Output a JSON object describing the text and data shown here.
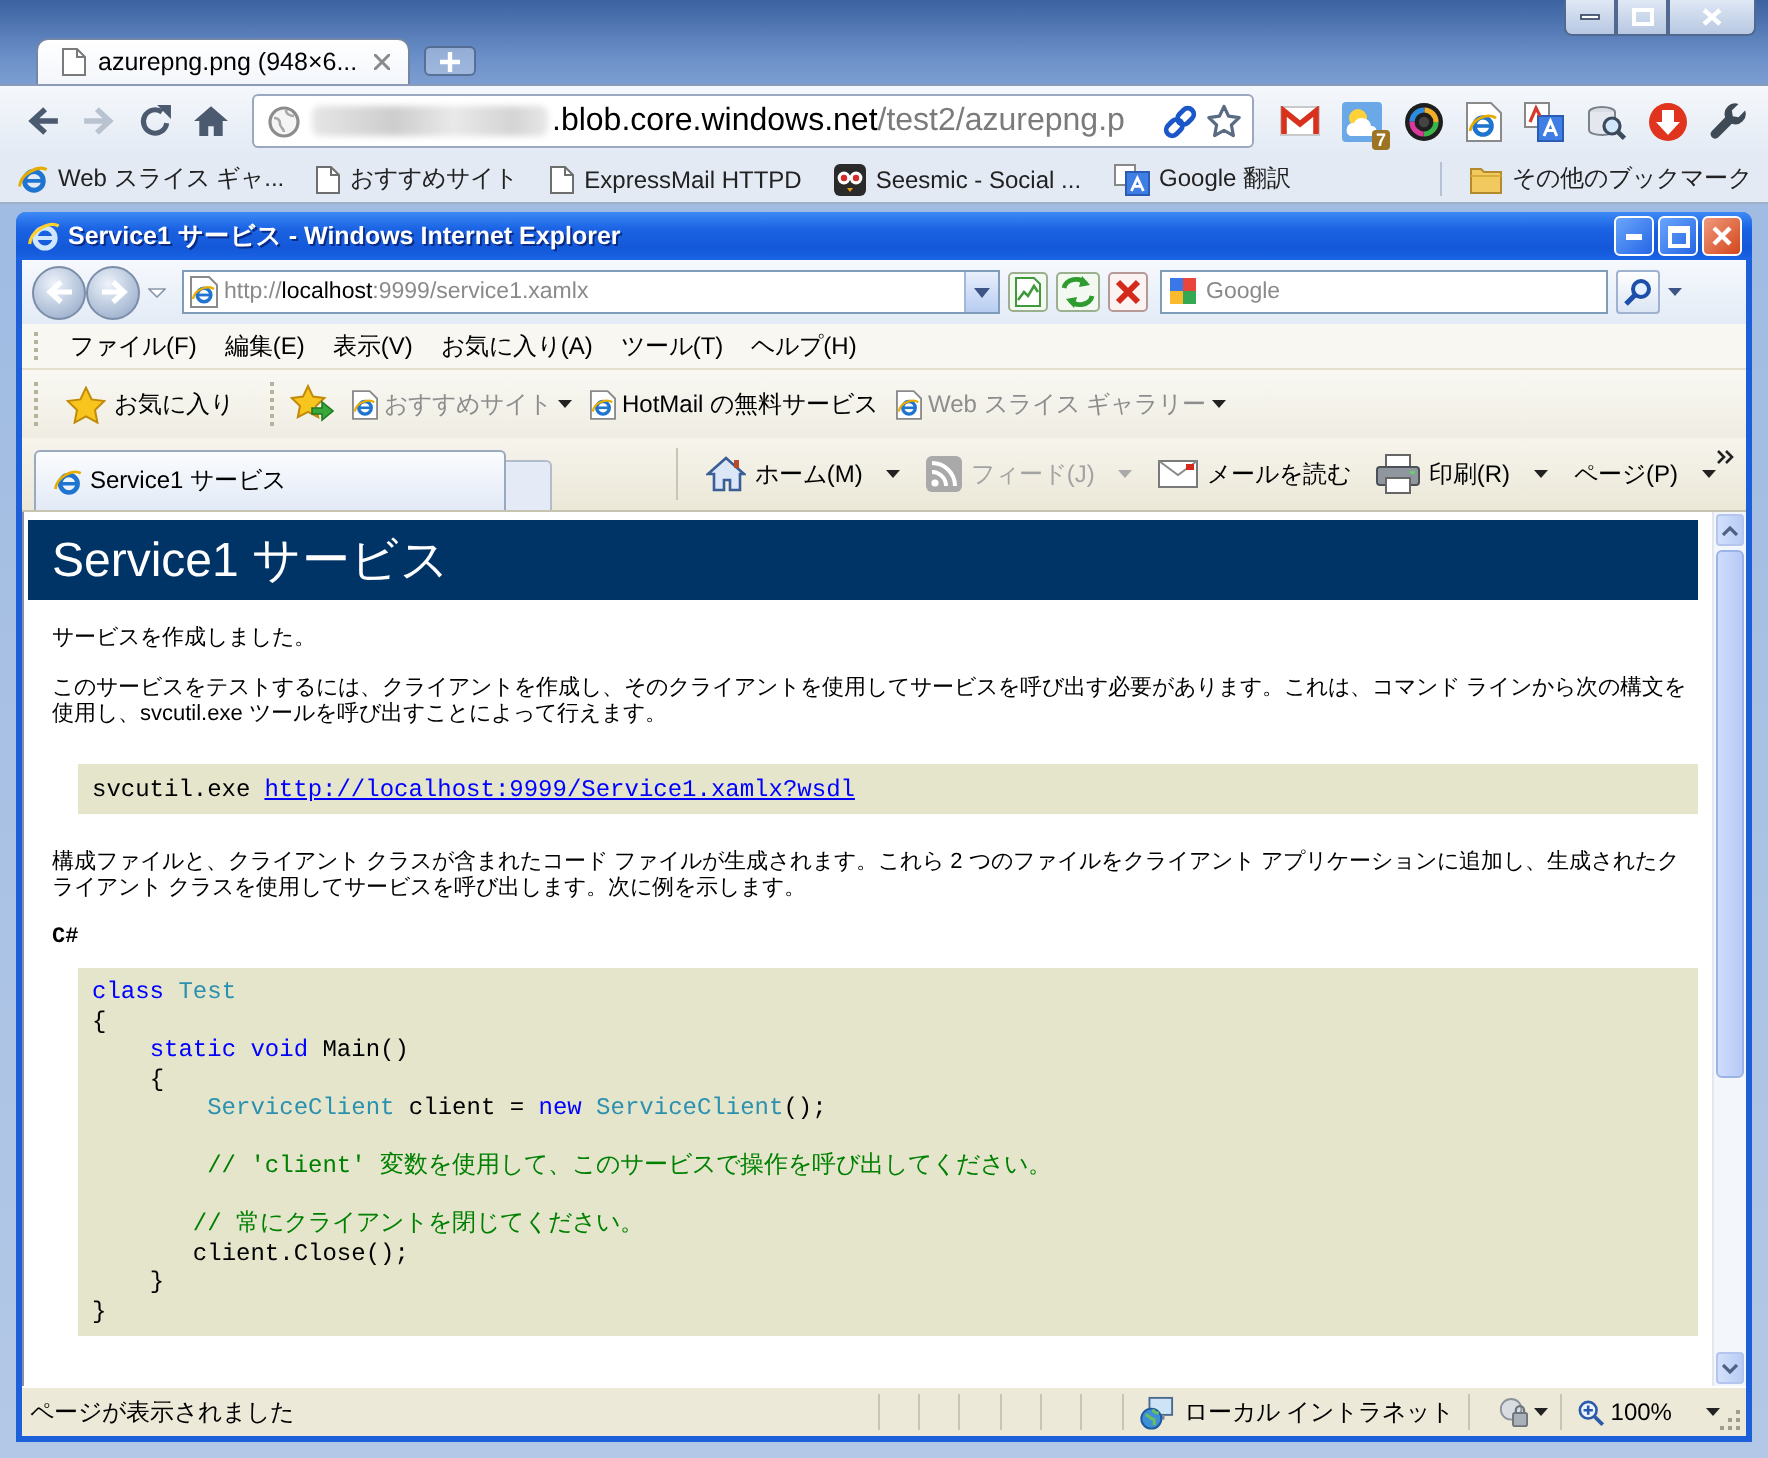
{
  "browser": {
    "tabs": [
      {
        "title": "azurepng.png (948×6...",
        "selected": true
      }
    ],
    "omnibox": {
      "host": ".blob.core.windows.net",
      "path": "/test2/azurepng.p"
    },
    "extension_badge": "7",
    "bookmarks": [
      {
        "label": "Web スライス ギャ...",
        "kind": "ie"
      },
      {
        "label": "おすすめサイト",
        "kind": "page"
      },
      {
        "label": "ExpressMail HTTPD",
        "kind": "page"
      },
      {
        "label": "Seesmic - Social ...",
        "kind": "owl"
      },
      {
        "label": "Google 翻訳",
        "kind": "translate"
      }
    ],
    "other_bookmarks": "その他のブックマーク"
  },
  "ie": {
    "title": "Service1 サービス - Windows Internet Explorer",
    "address": {
      "scheme": "http://",
      "host": "localhost",
      "rest": ":9999/service1.xamlx"
    },
    "search": {
      "placeholder": "Google"
    },
    "menu": [
      "ファイル(F)",
      "編集(E)",
      "表示(V)",
      "お気に入り(A)",
      "ツール(T)",
      "ヘルプ(H)"
    ],
    "favorites": {
      "label": "お気に入り",
      "links": [
        {
          "label": "おすすめサイト",
          "dropdown": true,
          "disabled": true
        },
        {
          "label": "HotMail の無料サービス",
          "dropdown": false,
          "disabled": false
        },
        {
          "label": "Web スライス ギャラリー",
          "dropdown": true,
          "disabled": true
        }
      ]
    },
    "tabs": [
      {
        "title": "Service1 サービス",
        "selected": true
      }
    ],
    "commands": [
      {
        "label": "ホーム(M)",
        "kind": "home",
        "dropdown": true,
        "disabled": false
      },
      {
        "label": "フィード(J)",
        "kind": "feed",
        "dropdown": true,
        "disabled": true
      },
      {
        "label": "メールを読む",
        "kind": "mail",
        "dropdown": false,
        "disabled": false
      },
      {
        "label": "印刷(R)",
        "kind": "print",
        "dropdown": true,
        "disabled": false
      },
      {
        "label": "ページ(P)",
        "kind": "page",
        "dropdown": true,
        "disabled": false
      }
    ],
    "page": {
      "heading": "Service1 サービス",
      "intro": "サービスを作成しました。",
      "paragraph_1": "このサービスをテストするには、クライアントを作成し、そのクライアントを使用してサービスを呼び出す必要があります。これは、コマンド ラインから次の構文を使用し、svcutil.exe ツールを呼び出すことによって行えます。",
      "command": {
        "program": "svcutil.exe",
        "link": "http://localhost:9999/Service1.xamlx?wsdl"
      },
      "paragraph_2": "構成ファイルと、クライアント クラスが含まれたコード ファイルが生成されます。これら 2 つのファイルをクライアント アプリケーションに追加し、生成されたクライアント クラスを使用してサービスを呼び出します。次に例を示します。",
      "language": "C#",
      "code_blocks": [
        {
          "lines": [
            {
              "tokens": [
                {
                  "kind": "keyword",
                  "text": "class"
                },
                {
                  "kind": "type",
                  "text": " Test"
                }
              ]
            },
            {
              "tokens": [
                {
                  "kind": "plain",
                  "text": "{"
                }
              ]
            },
            {
              "tokens": [
                {
                  "kind": "keyword",
                  "text": "    static void"
                },
                {
                  "kind": "plain",
                  "text": " Main()"
                }
              ]
            },
            {
              "tokens": [
                {
                  "kind": "plain",
                  "text": "    {"
                }
              ]
            },
            {
              "tokens": [
                {
                  "kind": "type",
                  "text": "        ServiceClient"
                },
                {
                  "kind": "plain",
                  "text": " client = "
                },
                {
                  "kind": "keyword",
                  "text": "new"
                },
                {
                  "kind": "type",
                  "text": " ServiceClient"
                },
                {
                  "kind": "plain",
                  "text": "();"
                }
              ]
            }
          ]
        },
        {
          "lines": [
            {
              "tokens": [
                {
                  "kind": "comment",
                  "text": "        // 'client' 変数を使用して、このサービスで操作を呼び出してください。"
                }
              ]
            }
          ]
        },
        {
          "lines": [
            {
              "tokens": [
                {
                  "kind": "comment",
                  "text": "       // 常にクライアントを閉じてください。"
                }
              ]
            },
            {
              "tokens": [
                {
                  "kind": "plain",
                  "text": "       client.Close();"
                }
              ]
            },
            {
              "tokens": [
                {
                  "kind": "plain",
                  "text": "    }"
                }
              ]
            },
            {
              "tokens": [
                {
                  "kind": "plain",
                  "text": "}"
                }
              ]
            }
          ]
        }
      ]
    },
    "status_bar": {
      "message": "ページが表示されました",
      "zone": "ローカル イントラネット",
      "zoom": "100%"
    }
  }
}
